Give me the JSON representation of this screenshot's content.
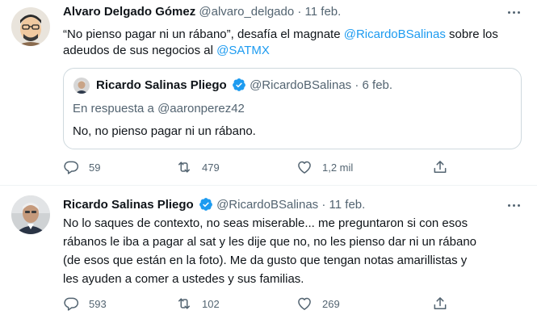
{
  "tweets": [
    {
      "author": {
        "name": "Alvaro Delgado Gómez",
        "handle": "@alvaro_delgado",
        "separator": "·",
        "date": "11 feb."
      },
      "text": {
        "pre": "“No pienso pagar ni un rábano”, desafía el magnate ",
        "mention1": "@RicardoBSalinas",
        "mid": " sobre los adeudos de sus negocios al ",
        "mention2": "@SATMX"
      },
      "quote": {
        "author": {
          "name": "Ricardo Salinas Pliego",
          "handle": "@RicardoBSalinas",
          "separator": "·",
          "date": "6 feb."
        },
        "reply_prefix": "En respuesta a ",
        "reply_to": "@aaronperez42",
        "text": "No, no pienso pagar ni un rábano."
      },
      "actions": {
        "replies": "59",
        "retweets": "479",
        "likes": "1,2 mil"
      }
    },
    {
      "author": {
        "name": "Ricardo Salinas Pliego",
        "handle": "@RicardoBSalinas",
        "separator": "·",
        "date": "11 feb."
      },
      "text": {
        "line1": "No lo saques de contexto, no seas miserable... me preguntaron si con esos",
        "line2": "rábanos le iba a pagar al sat y les dije que no, no les pienso dar ni un rábano",
        "line3": "(de esos que están en la foto). Me da gusto que tengan notas amarillistas y",
        "line4": "les ayuden a comer a ustedes y sus familias."
      },
      "actions": {
        "replies": "593",
        "retweets": "102",
        "likes": "269"
      }
    }
  ],
  "colors": {
    "accent": "#1d9bf0",
    "secondary_text": "#536471",
    "border": "#cfd9de",
    "verified": "#1d9bf0"
  },
  "icons": [
    "reply-icon",
    "retweet-icon",
    "like-icon",
    "share-icon",
    "more-icon",
    "verified-badge-icon"
  ]
}
